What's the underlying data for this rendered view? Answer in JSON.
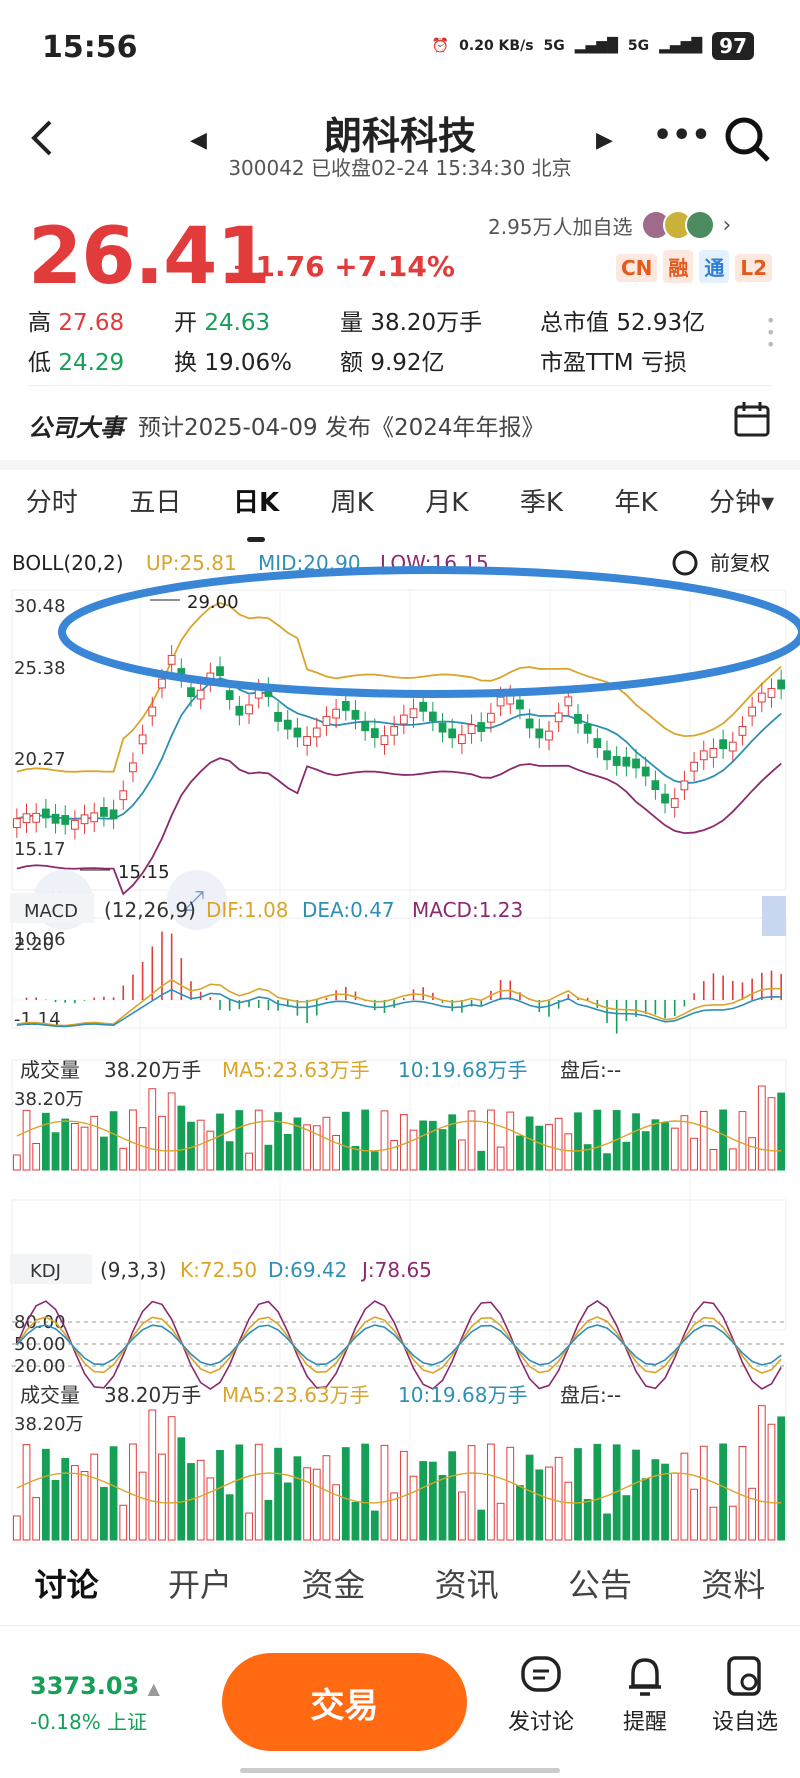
{
  "status": {
    "time": "15:56",
    "net_speed": "0.20 KB/s",
    "signal1": "5G",
    "signal2": "5G",
    "battery": "97"
  },
  "header": {
    "title": "朗科科技",
    "subtitle": "300042 已收盘02-24 15:34:30 北京"
  },
  "quote": {
    "price": "26.41",
    "change": "+1.76",
    "change_pct": "+7.14%",
    "watchers": "2.95万人加自选",
    "tags": [
      "CN",
      "融",
      "通",
      "L2"
    ],
    "high_label": "高",
    "high": "27.68",
    "low_label": "低",
    "low": "24.29",
    "open_label": "开",
    "open": "24.63",
    "turnover_label": "换",
    "turnover": "19.06%",
    "volume_label": "量",
    "volume": "38.20万手",
    "amount_label": "额",
    "amount": "9.92亿",
    "mktcap_label": "总市值",
    "mktcap": "52.93亿",
    "pe_label": "市盈TTM",
    "pe": "亏损"
  },
  "event": {
    "label": "公司大事",
    "text": "预计2025-04-09 发布《2024年年报》"
  },
  "tabs": [
    "分时",
    "五日",
    "日K",
    "周K",
    "月K",
    "季K",
    "年K",
    "分钟▾"
  ],
  "active_tab": "日K",
  "boll": {
    "name": "BOLL(20,2)",
    "up": "UP:25.81",
    "mid": "MID:20.90",
    "low": "LOW:16.15",
    "restore": "前复权",
    "y_labels": [
      "30.48",
      "25.38",
      "20.27",
      "15.17",
      "10.06"
    ],
    "max_label": "29.00",
    "min_label": "15.15"
  },
  "macd": {
    "name": "MACD",
    "params": "(12,26,9)",
    "dif": "DIF:1.08",
    "dea": "DEA:0.47",
    "macd": "MACD:1.23",
    "y_top": "2.20",
    "y_bottom": "-1.14"
  },
  "vol1": {
    "name": "成交量",
    "v": "38.20万手",
    "ma5": "MA5:23.63万手",
    "ma10": "10:19.68万手",
    "after": "盘后:--",
    "y_top": "38.20万"
  },
  "kdj": {
    "name": "KDJ",
    "params": "(9,3,3)",
    "k": "K:72.50",
    "d": "D:69.42",
    "j": "J:78.65",
    "levels": [
      "80.00",
      "50.00",
      "20.00"
    ]
  },
  "vol2": {
    "name": "成交量",
    "v": "38.20万手",
    "ma5": "MA5:23.63万手",
    "ma10": "10:19.68万手",
    "after": "盘后:--",
    "y_top": "38.20万"
  },
  "bottom_tabs": [
    "讨论",
    "开户",
    "资金",
    "资讯",
    "公告",
    "资料"
  ],
  "footer": {
    "index_value": "3373.03",
    "index_change": "-0.18% 上证",
    "trade": "交易",
    "discuss": "发讨论",
    "alert": "提醒",
    "watch": "设自选"
  },
  "colors": {
    "up": "#e23b3b",
    "down": "#16a057",
    "accent": "#ff6a13",
    "boll_up": "#d9a52b",
    "boll_mid": "#2f8fb5",
    "boll_low": "#8b2a6e",
    "annotation": "#3a86d6"
  }
}
